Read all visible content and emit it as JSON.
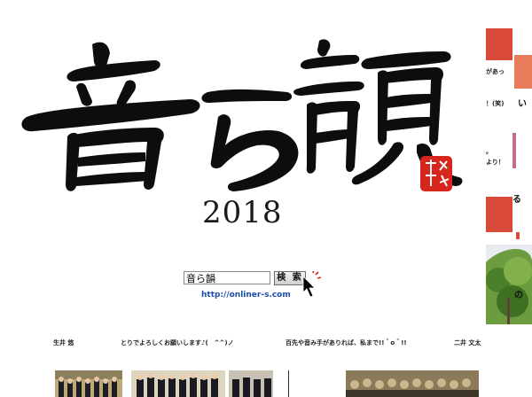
{
  "logo": {
    "text": "音ら韻",
    "seal_text": "音ら韻",
    "ink_color": "#0d0d0d",
    "seal_color": "#d7261e"
  },
  "year": "2018",
  "search": {
    "value": "音ら韻",
    "button_label": "検 索"
  },
  "url": "http://onliner-s.com",
  "right_column": {
    "snippets": [
      "があっ",
      "！(笑)",
      "。",
      "より！"
    ],
    "big_chars": [
      "い",
      "る",
      "の"
    ],
    "accent_colors": [
      "#d94a3a",
      "#e87b5a",
      "#c76b86"
    ]
  },
  "bottom_strip": {
    "texts": [
      "生井 悠",
      "とりでよろしくお願いします♪(　^^)ノ",
      "百先や音み手がありれば、私まで!!＾o＾!!",
      "二井 文太"
    ]
  }
}
